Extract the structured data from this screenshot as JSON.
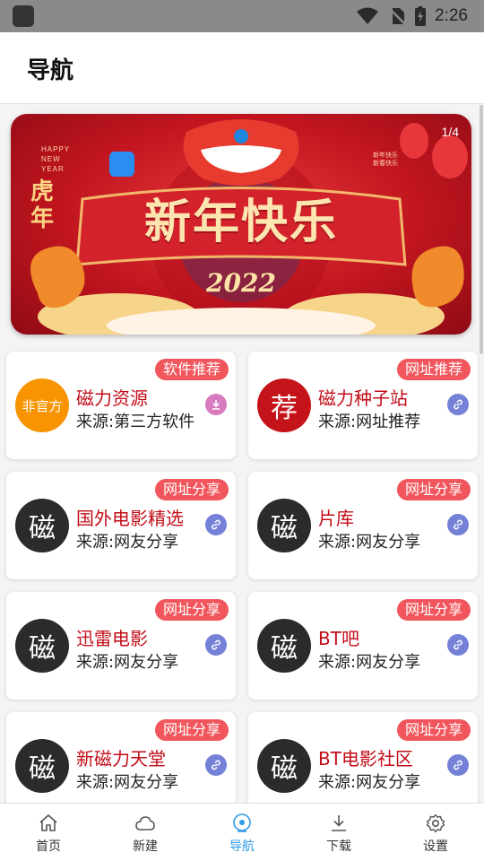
{
  "status_bar": {
    "time": "2:26"
  },
  "appbar": {
    "title": "导航"
  },
  "banner": {
    "pager": "1/4",
    "greeting": "新年快乐",
    "year": "2022",
    "tiger_year": "虎年",
    "small_text": "HAPPY NEW YEAR",
    "vertical_text": "新年快乐 新春快乐"
  },
  "cards": [
    {
      "badge": "软件推荐",
      "icon_text": "非官方",
      "icon_color": "#f79400",
      "icon_font": 15,
      "title": "磁力资源",
      "subtitle": "来源:第三方软件",
      "action_icon": "download-icon",
      "action_color": "#d77bbf"
    },
    {
      "badge": "网址推荐",
      "icon_text": "荐",
      "icon_color": "#c4141a",
      "icon_font": 30,
      "title": "磁力种子站",
      "subtitle": "来源:网址推荐",
      "action_icon": "link-icon",
      "action_color": "#7481d6"
    },
    {
      "badge": "网址分享",
      "icon_text": "磁",
      "icon_color": "#2b2b2b",
      "icon_font": 30,
      "title": "国外电影精选",
      "subtitle": "来源:网友分享",
      "action_icon": "link-icon",
      "action_color": "#7481d6"
    },
    {
      "badge": "网址分享",
      "icon_text": "磁",
      "icon_color": "#2b2b2b",
      "icon_font": 30,
      "title": "片库",
      "subtitle": "来源:网友分享",
      "action_icon": "link-icon",
      "action_color": "#7481d6"
    },
    {
      "badge": "网址分享",
      "icon_text": "磁",
      "icon_color": "#2b2b2b",
      "icon_font": 30,
      "title": "迅雷电影",
      "subtitle": "来源:网友分享",
      "action_icon": "link-icon",
      "action_color": "#7481d6"
    },
    {
      "badge": "网址分享",
      "icon_text": "磁",
      "icon_color": "#2b2b2b",
      "icon_font": 30,
      "title": "BT吧",
      "subtitle": "来源:网友分享",
      "action_icon": "link-icon",
      "action_color": "#7481d6"
    },
    {
      "badge": "网址分享",
      "icon_text": "磁",
      "icon_color": "#2b2b2b",
      "icon_font": 30,
      "title": "新磁力天堂",
      "subtitle": "来源:网友分享",
      "action_icon": "link-icon",
      "action_color": "#7481d6"
    },
    {
      "badge": "网址分享",
      "icon_text": "磁",
      "icon_color": "#2b2b2b",
      "icon_font": 30,
      "title": "BT电影社区",
      "subtitle": "来源:网友分享",
      "action_icon": "link-icon",
      "action_color": "#7481d6"
    }
  ],
  "bottom_nav": [
    {
      "label": "首页",
      "icon": "home-icon",
      "active": false
    },
    {
      "label": "新建",
      "icon": "cloud-icon",
      "active": false
    },
    {
      "label": "导航",
      "icon": "compass-icon",
      "active": true
    },
    {
      "label": "下载",
      "icon": "download-icon",
      "active": false
    },
    {
      "label": "设置",
      "icon": "gear-icon",
      "active": false
    }
  ],
  "colors": {
    "accent": "#2f9be2",
    "badge": "#f0565c",
    "title_red": "#c20d18"
  }
}
